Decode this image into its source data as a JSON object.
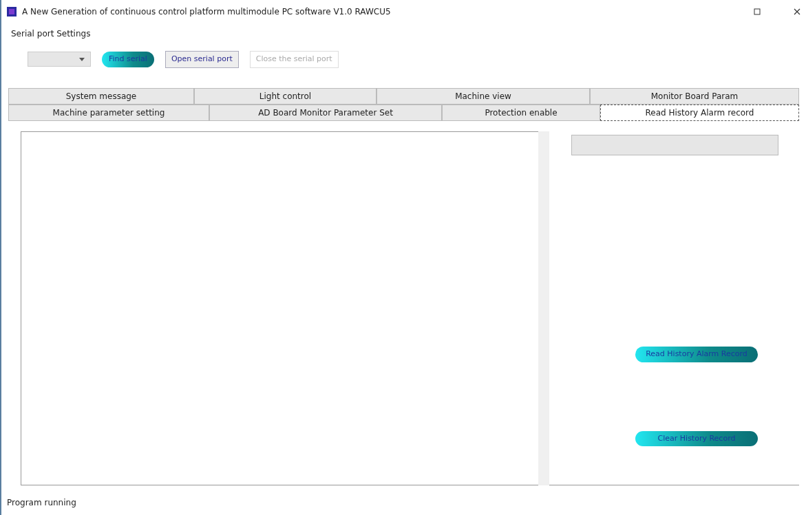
{
  "window": {
    "title": "A New Generation of continuous control platform multimodule PC software V1.0 RAWCU5"
  },
  "serial_settings": {
    "title": "Serial port Settings",
    "buttons": [
      {
        "label": "Find serial",
        "kind": "pill",
        "disabled": false
      },
      {
        "label": "Open serial port",
        "kind": "flat",
        "disabled": false
      },
      {
        "label": "Close the serial port",
        "kind": "flat",
        "disabled": true
      }
    ]
  },
  "tab_rows": [
    [
      {
        "label": "System message",
        "selected": false
      },
      {
        "label": "Light control",
        "selected": false
      },
      {
        "label": "Machine view",
        "selected": false
      },
      {
        "label": "Monitor Board Param",
        "selected": false
      }
    ],
    [
      {
        "label": "Machine parameter setting",
        "selected": false
      },
      {
        "label": "AD Board Monitor Parameter Set",
        "selected": false
      },
      {
        "label": "Protection enable",
        "selected": false
      },
      {
        "label": "Read History Alarm record",
        "selected": true
      }
    ]
  ],
  "side_buttons": [
    {
      "label": "Read History Alarm Record"
    },
    {
      "label": "Clear History Record"
    }
  ],
  "status_bar": "Program running"
}
